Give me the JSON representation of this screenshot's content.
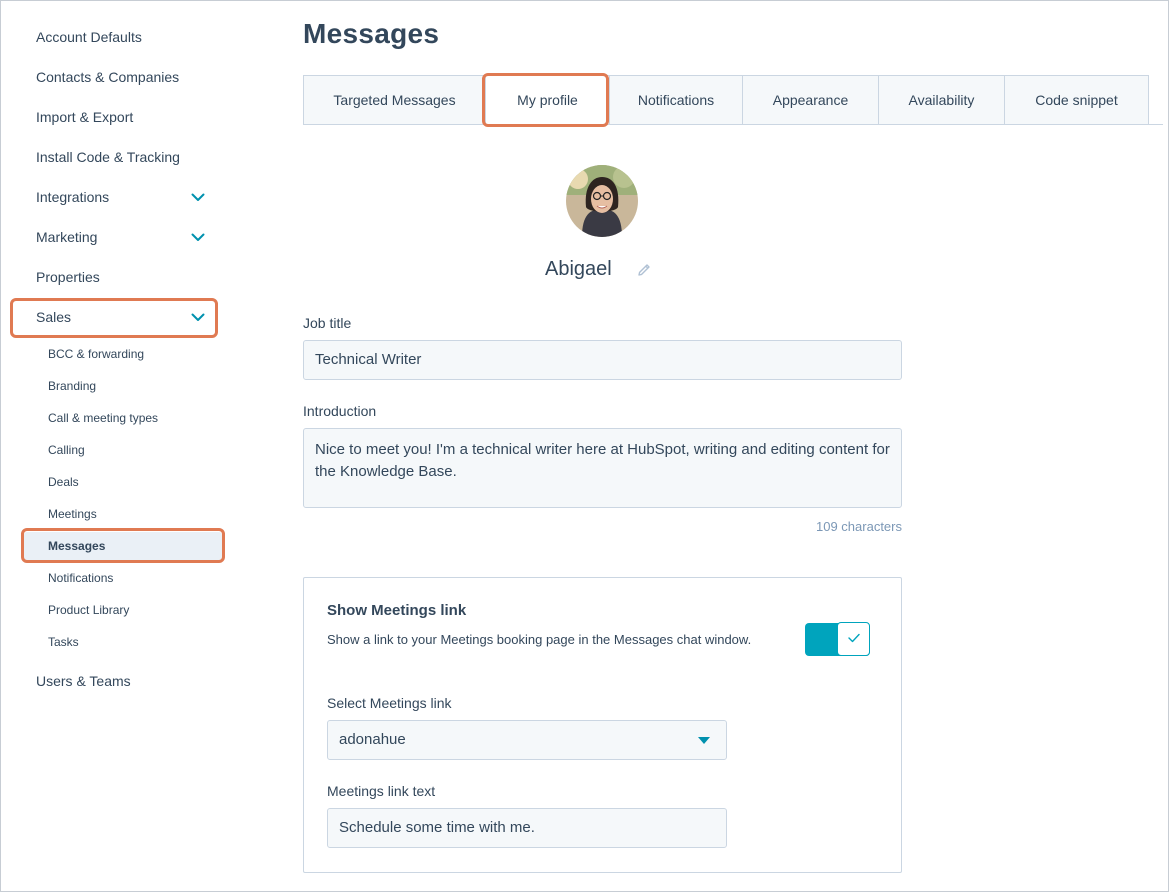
{
  "sidebar": {
    "items": [
      {
        "label": "Account Defaults"
      },
      {
        "label": "Contacts & Companies"
      },
      {
        "label": "Import & Export"
      },
      {
        "label": "Install Code & Tracking"
      },
      {
        "label": "Integrations"
      },
      {
        "label": "Marketing"
      },
      {
        "label": "Properties"
      },
      {
        "label": "Sales"
      },
      {
        "label": "Users & Teams"
      }
    ],
    "sales_subitems": [
      {
        "label": "BCC & forwarding"
      },
      {
        "label": "Branding"
      },
      {
        "label": "Call & meeting types"
      },
      {
        "label": "Calling"
      },
      {
        "label": "Deals"
      },
      {
        "label": "Meetings"
      },
      {
        "label": "Messages"
      },
      {
        "label": "Notifications"
      },
      {
        "label": "Product Library"
      },
      {
        "label": "Tasks"
      }
    ],
    "chevron_icon": "chevron-down-icon",
    "accent_color": "#0091ae",
    "highlight_color": "#e07a52"
  },
  "main": {
    "title": "Messages",
    "tabs": [
      {
        "label": "Targeted Messages"
      },
      {
        "label": "My profile"
      },
      {
        "label": "Notifications"
      },
      {
        "label": "Appearance"
      },
      {
        "label": "Availability"
      },
      {
        "label": "Code snippet"
      }
    ],
    "active_tab": "My profile",
    "profile": {
      "name": "Abigael",
      "edit_icon": "pencil-icon"
    },
    "job_title": {
      "label": "Job title",
      "value": "Technical Writer"
    },
    "introduction": {
      "label": "Introduction",
      "value": "Nice to meet you! I'm a technical writer here at HubSpot, writing and editing content for the Knowledge Base.",
      "char_count": "109 characters"
    },
    "meetings_card": {
      "title": "Show Meetings link",
      "description": "Show a link to your Meetings booking page in the Messages chat window.",
      "toggle_on": true,
      "toggle_color": "#00a4bd",
      "select_label": "Select Meetings link",
      "select_value": "adonahue",
      "link_text_label": "Meetings link text",
      "link_text_value": "Schedule some time with me."
    }
  }
}
